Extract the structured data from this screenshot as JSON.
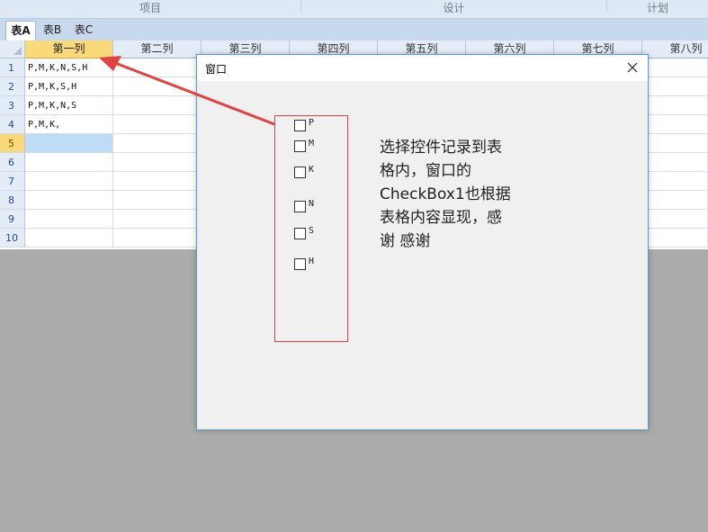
{
  "ribbon": {
    "groups": [
      {
        "label": "项目"
      },
      {
        "label": "设计"
      },
      {
        "label": "计划"
      }
    ]
  },
  "sheet_tabs": [
    {
      "label": "表A",
      "active": true
    },
    {
      "label": "表B",
      "active": false
    },
    {
      "label": "表C",
      "active": false
    }
  ],
  "grid": {
    "columns": [
      "第一列",
      "第二列",
      "第三列",
      "第四列",
      "第五列",
      "第六列",
      "第七列",
      "第八列"
    ],
    "rows": [
      {
        "num": "1",
        "c1": "P,M,K,N,S,H"
      },
      {
        "num": "2",
        "c1": "P,M,K,S,H"
      },
      {
        "num": "3",
        "c1": "P,M,K,N,S"
      },
      {
        "num": "4",
        "c1": "P,M,K,"
      },
      {
        "num": "5",
        "c1": ""
      },
      {
        "num": "6",
        "c1": ""
      },
      {
        "num": "7",
        "c1": ""
      },
      {
        "num": "8",
        "c1": ""
      },
      {
        "num": "9",
        "c1": ""
      },
      {
        "num": "10",
        "c1": ""
      }
    ]
  },
  "dialog": {
    "title": "窗口",
    "close_icon": "close-icon",
    "checkboxes": [
      {
        "label": "P",
        "checked": false
      },
      {
        "label": "M",
        "checked": false
      },
      {
        "label": "K",
        "checked": false
      },
      {
        "label": "N",
        "checked": false
      },
      {
        "label": "S",
        "checked": false
      },
      {
        "label": "H",
        "checked": false
      }
    ],
    "note": "选择控件记录到表\n格内，窗口的\nCheckBox1也根据\n表格内容显现，感\n谢 感谢"
  },
  "colors": {
    "annotation_red": "#e04343",
    "selected_header": "#f9d97a",
    "selected_cell": "#bfdcf7",
    "dialog_border": "#5c9ad6"
  }
}
